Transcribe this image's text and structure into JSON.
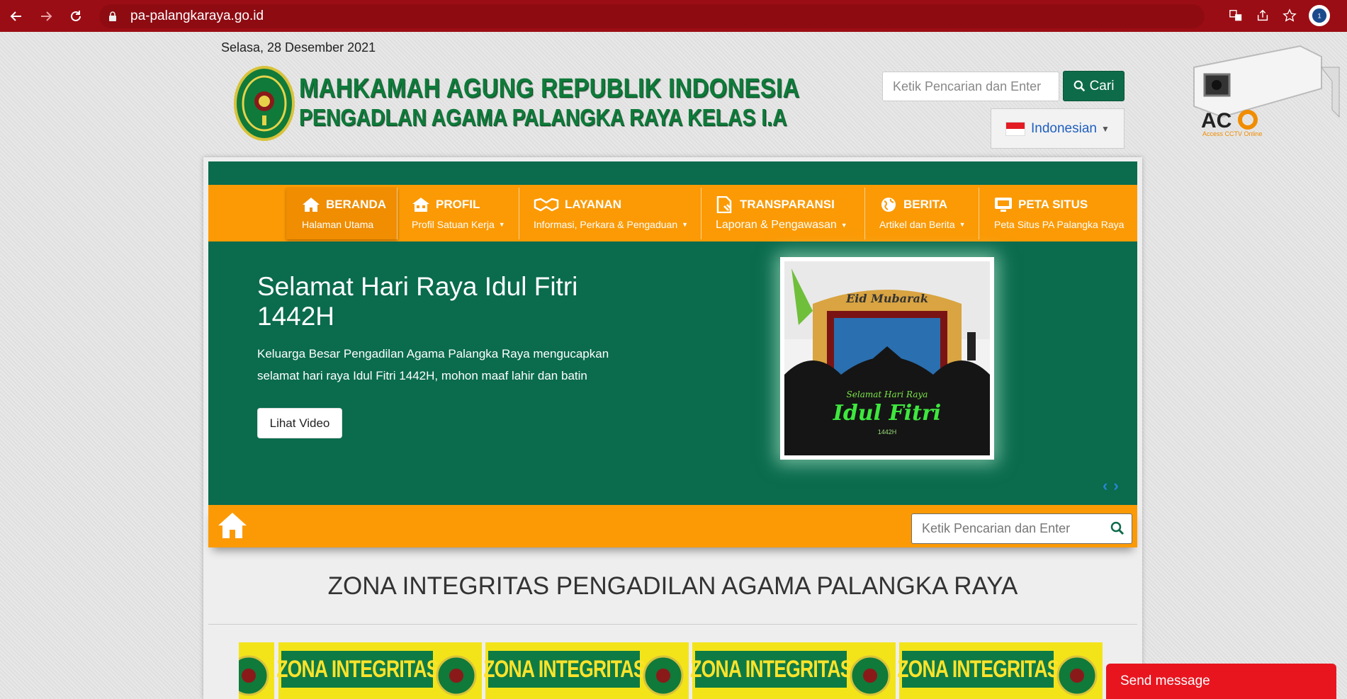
{
  "browser": {
    "url": "pa-palangkaraya.go.id"
  },
  "header": {
    "date": "Selasa, 28 Desember 2021",
    "title_line1": "MAHKAMAH AGUNG REPUBLIK INDONESIA",
    "title_line2": "PENGADLAN AGAMA PALANGKA RAYA KELAS I.A",
    "search_placeholder": "Ketik Pencarian dan Enter",
    "search_button": "Cari",
    "language": "Indonesian",
    "cctv_brand": "AC",
    "cctv_caption": "Access CCTV Online"
  },
  "menu": {
    "items": [
      {
        "title": "BERANDA",
        "subtitle": "Halaman Utama",
        "has_dropdown": false
      },
      {
        "title": "PROFIL",
        "subtitle": "Profil Satuan Kerja",
        "has_dropdown": true
      },
      {
        "title": "LAYANAN",
        "subtitle": "Informasi, Perkara & Pengaduan",
        "has_dropdown": true
      },
      {
        "title": "TRANSPARANSI",
        "subtitle": "Laporan & Pengawasan",
        "has_dropdown": true
      },
      {
        "title": "BERITA",
        "subtitle": "Artikel dan Berita",
        "has_dropdown": true
      },
      {
        "title": "PETA SITUS",
        "subtitle": "Peta Situs PA Palangka Raya",
        "has_dropdown": false
      }
    ]
  },
  "hero": {
    "title": "Selamat Hari Raya Idul Fitri 1442H",
    "text": "Keluarga Besar Pengadilan Agama Palangka Raya mengucapkan selamat hari raya Idul Fitri 1442H, mohon maaf lahir dan batin",
    "button": "Lihat Video",
    "image_text_top": "Eid Mubarak",
    "image_text_mid": "Selamat Hari Raya",
    "image_text_main": "Idul Fitri",
    "image_text_year": "1442H"
  },
  "bottom_bar": {
    "search_placeholder": "Ketik Pencarian dan Enter"
  },
  "zona": {
    "title": "ZONA INTEGRITAS PENGADILAN AGAMA PALANGKA RAYA",
    "banner_label": "ZONA INTEGRITAS"
  },
  "chat": {
    "label": "Send message"
  },
  "colors": {
    "chrome": "#9b0d14",
    "green": "#0a6b4d",
    "orange": "#fb9a05",
    "chat_red": "#e8151f"
  }
}
